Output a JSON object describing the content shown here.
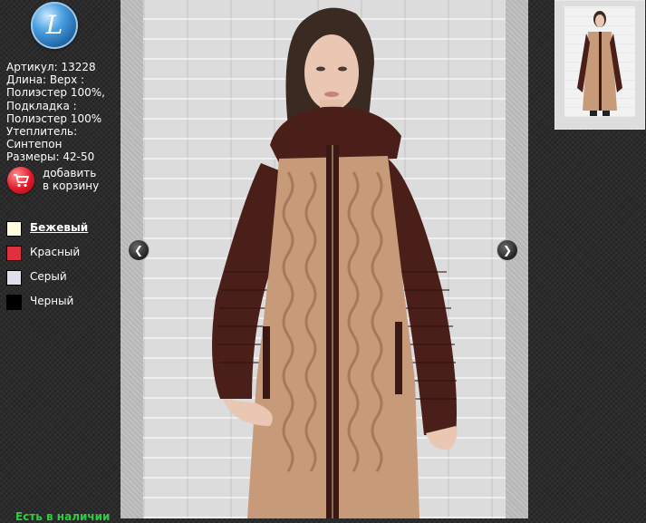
{
  "brand": {
    "logo_letter": "L"
  },
  "product": {
    "specs": [
      "Артикул: 13228",
      "Длина: Верх :",
      "Полиэстер 100%,",
      "Подкладка :",
      "Полиэстер 100%",
      "Утеплитель:",
      "Синтепон",
      "Размеры: 42-50"
    ]
  },
  "cart": {
    "label_line1": "добавить",
    "label_line2": "в корзину",
    "icon": "cart-icon"
  },
  "colors": [
    {
      "name": "Бежевый",
      "hex": "#fffbe0",
      "selected": true
    },
    {
      "name": "Красный",
      "hex": "#e03040",
      "selected": false
    },
    {
      "name": "Серый",
      "hex": "#e0e0ea",
      "selected": false
    },
    {
      "name": "Черный",
      "hex": "#000000",
      "selected": false
    }
  ],
  "availability": {
    "text": "Есть в наличии"
  },
  "gallery": {
    "prev_icon": "chevron-left-icon",
    "next_icon": "chevron-right-icon",
    "prev_glyph": "❮",
    "next_glyph": "❯",
    "coat_colors": {
      "sleeve": "#4a1f1a",
      "knit": "#c79a7a",
      "zipper": "#3a1814",
      "wall": "#dcdcdc"
    }
  }
}
